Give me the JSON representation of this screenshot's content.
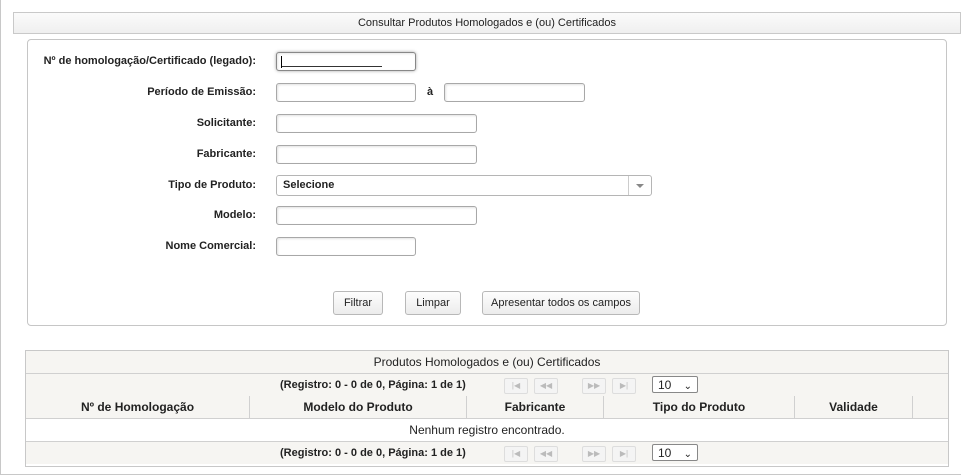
{
  "header": {
    "title": "Consultar Produtos Homologados e (ou) Certificados"
  },
  "form": {
    "fields": [
      {
        "label": "Nº de homologação/Certificado (legado):",
        "value": ""
      },
      {
        "label": "Período de Emissão:",
        "value": "",
        "separator": "à",
        "value_end": ""
      },
      {
        "label": "Solicitante:",
        "value": ""
      },
      {
        "label": "Fabricante:",
        "value": ""
      },
      {
        "label": "Tipo de Produto:",
        "selected": "Selecione"
      },
      {
        "label": "Modelo:",
        "value": ""
      },
      {
        "label": "Nome Comercial:",
        "value": ""
      }
    ],
    "buttons": {
      "filter": "Filtrar",
      "clear": "Limpar",
      "show_all": "Apresentar todos os campos"
    }
  },
  "results": {
    "caption": "Produtos Homologados e (ou) Certificados",
    "pager_info": "(Registro: 0 - 0 de 0, Página: 1 de 1)",
    "pager_buttons": [
      "|◀",
      "◀◀",
      "▶▶",
      "▶|"
    ],
    "rows_per_page": "10",
    "columns": [
      "Nº de Homologação",
      "Modelo do Produto",
      "Fabricante",
      "Tipo do Produto",
      "Validade"
    ],
    "empty_message": "Nenhum registro encontrado."
  }
}
